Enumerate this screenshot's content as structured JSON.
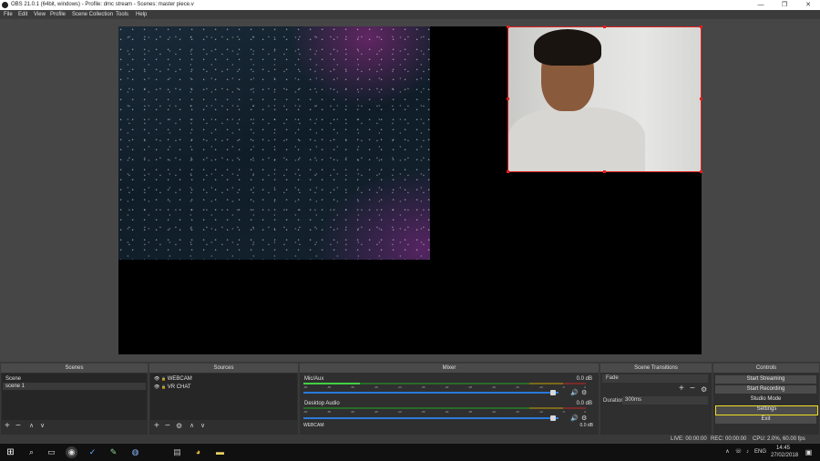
{
  "window": {
    "title": "OBS 21.0.1 (64bit, windows) - Profile: dmc stream - Scenes: master piece.v",
    "minimize": "—",
    "maximize": "❐",
    "close": "✕"
  },
  "menu": [
    "File",
    "Edit",
    "View",
    "Profile",
    "Scene Collection",
    "Tools",
    "Help"
  ],
  "scenes": {
    "header": "Scenes",
    "items": [
      "Scene",
      "scene 1"
    ]
  },
  "sources": {
    "header": "Sources",
    "items": [
      "WEBCAM",
      "VR CHAT"
    ]
  },
  "mixer": {
    "header": "Mixer",
    "ticks": [
      "-60",
      "-55",
      "-50",
      "-45",
      "-40",
      "-35",
      "-30",
      "-25",
      "-20",
      "-15",
      "-10",
      "-5",
      "0"
    ],
    "channels": [
      {
        "name": "Mic/Aux",
        "db": "0.0 dB",
        "level": 0.2,
        "volume": 0.98
      },
      {
        "name": "Desktop Audio",
        "db": "0.0 dB",
        "level": 0.0,
        "volume": 0.98
      },
      {
        "name": "WEBCAM",
        "db": "0.0 dB",
        "level": 0.0,
        "volume": 0.98
      }
    ]
  },
  "transitions": {
    "header": "Scene Transitions",
    "selected": "Fade",
    "duration_label": "Duration",
    "duration_value": "300ms"
  },
  "controls": {
    "header": "Controls",
    "start_streaming": "Start Streaming",
    "start_recording": "Start Recording",
    "studio_mode": "Studio Mode",
    "settings": "Settings",
    "exit": "Exit",
    "highlight_color": "#f0e020"
  },
  "status": {
    "live": "LIVE: 00:00:00",
    "rec": "REC: 00:00:00",
    "cpu": "CPU: 2.0%, 60.00 fps"
  },
  "taskbar": {
    "time": "14:45",
    "date": "27/02/2018",
    "lang": "ENG"
  },
  "icons": {
    "add": "+",
    "remove": "−",
    "up": "∧",
    "down": "∨",
    "gear": "⚙",
    "eye": "👁",
    "lock": "🔒",
    "speaker": "🔊"
  },
  "colors": {
    "accent_selection": "#e02020",
    "meter_green": "#42d142",
    "fader_blue": "#2a7ad8"
  }
}
